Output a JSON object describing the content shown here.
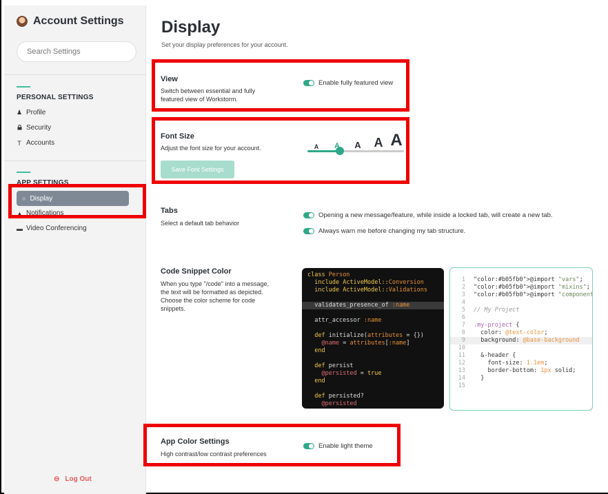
{
  "sidebar": {
    "title": "Account Settings",
    "search_placeholder": "Search Settings",
    "personal_section": "PERSONAL SETTINGS",
    "personal_items": [
      {
        "label": "Profile",
        "icon": "person-icon"
      },
      {
        "label": "Security",
        "icon": "lock-icon"
      },
      {
        "label": "Accounts",
        "icon": "accounts-icon"
      }
    ],
    "app_section": "APP SETTINGS",
    "app_items": [
      {
        "label": "Display",
        "icon": "gear-icon",
        "active": true
      },
      {
        "label": "Notifications",
        "icon": "bell-icon"
      },
      {
        "label": "Video Conferencing",
        "icon": "video-icon"
      }
    ],
    "logout": "Log Out"
  },
  "main": {
    "title": "Display",
    "subtitle": "Set your display preferences for your account.",
    "view": {
      "title": "View",
      "desc_line1": "Switch between essential and fully",
      "desc_line2": "featured view of Workstorm.",
      "toggle_label": "Enable fully featured view",
      "toggle_on": true
    },
    "font_size": {
      "title": "Font Size",
      "desc": "Adjust the font size for your account.",
      "letters": [
        "A",
        "A",
        "A",
        "A",
        "A"
      ],
      "selected_index": 1,
      "save_label": "Save Font Settings"
    },
    "tabs": {
      "title": "Tabs",
      "desc": "Select a default tab behavior",
      "option1": "Opening a new message/feature, while inside a locked tab, will create a new tab.",
      "option2": "Always warn me before changing my tab structure."
    },
    "code_snippet": {
      "title": "Code Snippet Color",
      "desc_lines": [
        "When you type \"/code\" into a message,",
        "the text will be formatted as depicted.",
        "Choose the color scheme for code",
        "snippets."
      ],
      "dark_lines": [
        "class Person",
        "  include ActiveModel::Conversion",
        "  include ActiveModel::Validations",
        "",
        "  validates_presence_of :name",
        "",
        "  attr_accessor :name",
        "",
        "  def initialize(attributes = {})",
        "    @name = attributes[:name]",
        "  end",
        "",
        "  def persist",
        "    @persisted = true",
        "  end",
        "",
        "  def persisted?",
        "    @persisted"
      ],
      "light_lines": [
        {
          "n": "1",
          "t": "@import \"vars\";"
        },
        {
          "n": "2",
          "t": "@import \"mixins\";"
        },
        {
          "n": "3",
          "t": "@import \"components\";"
        },
        {
          "n": "4",
          "t": ""
        },
        {
          "n": "5",
          "t": "// My Project"
        },
        {
          "n": "6",
          "t": ""
        },
        {
          "n": "7",
          "t": ".my-project {"
        },
        {
          "n": "8",
          "t": "  color: @text-color;"
        },
        {
          "n": "9",
          "t": "  background: @base-background"
        },
        {
          "n": "10",
          "t": ""
        },
        {
          "n": "11",
          "t": "  &-header {"
        },
        {
          "n": "12",
          "t": "    font-size: 1.1em;"
        },
        {
          "n": "13",
          "t": "    border-bottom: 1px solid;"
        },
        {
          "n": "14",
          "t": "  }"
        },
        {
          "n": "15",
          "t": ""
        }
      ]
    },
    "app_color": {
      "title": "App Color Settings",
      "desc": "High contrast/low contrast preferences",
      "toggle_label": "Enable light theme"
    }
  },
  "colors": {
    "accent": "#2ea88a",
    "highlight_border": "#ee0000",
    "logout": "#e65a5a",
    "active_nav": "#7f8996"
  }
}
